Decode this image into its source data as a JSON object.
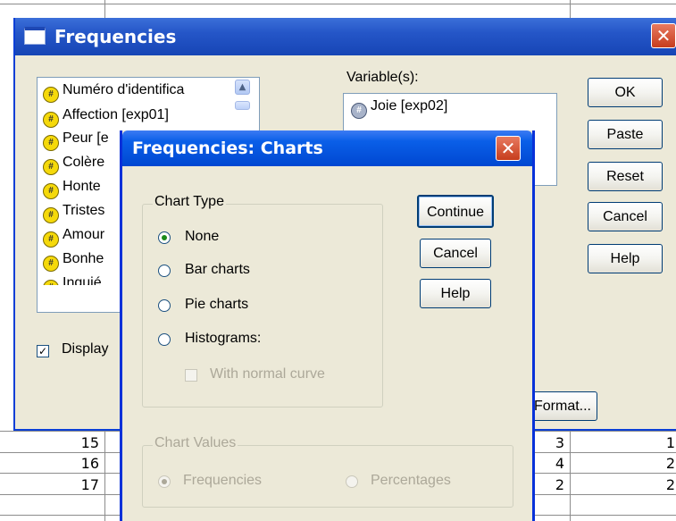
{
  "background_grid": {
    "rows": [
      {
        "case": "15",
        "col_a": "3",
        "col_b": "1"
      },
      {
        "case": "16",
        "col_a": "4",
        "col_b": "2"
      },
      {
        "case": "17",
        "col_a": "2",
        "col_b": "2"
      }
    ]
  },
  "frequencies_dialog": {
    "title": "Frequencies",
    "close_label": "✕",
    "source_list": [
      "Numéro d'identifica",
      "Affection [exp01]",
      "Peur [e",
      "Colère",
      "Honte",
      "Tristes",
      "Amour",
      "Bonhe",
      "Inquié"
    ],
    "variables_label": "Variable(s):",
    "selected_variables": [
      "Joie [exp02]"
    ],
    "buttons": {
      "ok": "OK",
      "paste": "Paste",
      "reset": "Reset",
      "cancel": "Cancel",
      "help": "Help",
      "format": "Format..."
    },
    "display_checkbox": {
      "label": "Display",
      "checked": true
    },
    "icons": {
      "window": "window-icon",
      "variable": "scale-variable-icon"
    }
  },
  "charts_dialog": {
    "title": "Frequencies: Charts",
    "close_label": "✕",
    "chart_type": {
      "legend": "Chart Type",
      "options": [
        "None",
        "Bar charts",
        "Pie charts",
        "Histograms:"
      ],
      "selected": "None",
      "normal_curve": {
        "label": "With normal curve",
        "checked": false,
        "enabled": false
      }
    },
    "chart_values": {
      "legend": "Chart Values",
      "enabled": false,
      "options": [
        "Frequencies",
        "Percentages"
      ],
      "selected": "Frequencies"
    },
    "buttons": {
      "continue": "Continue",
      "cancel": "Cancel",
      "help": "Help"
    }
  },
  "colors": {
    "xp_title_blue": "#0a5fe8",
    "dialog_face": "#ece9d8",
    "close_red": "#d9502f",
    "disabled_text": "#aca899",
    "variable_icon_yellow": "#f5d90a"
  }
}
